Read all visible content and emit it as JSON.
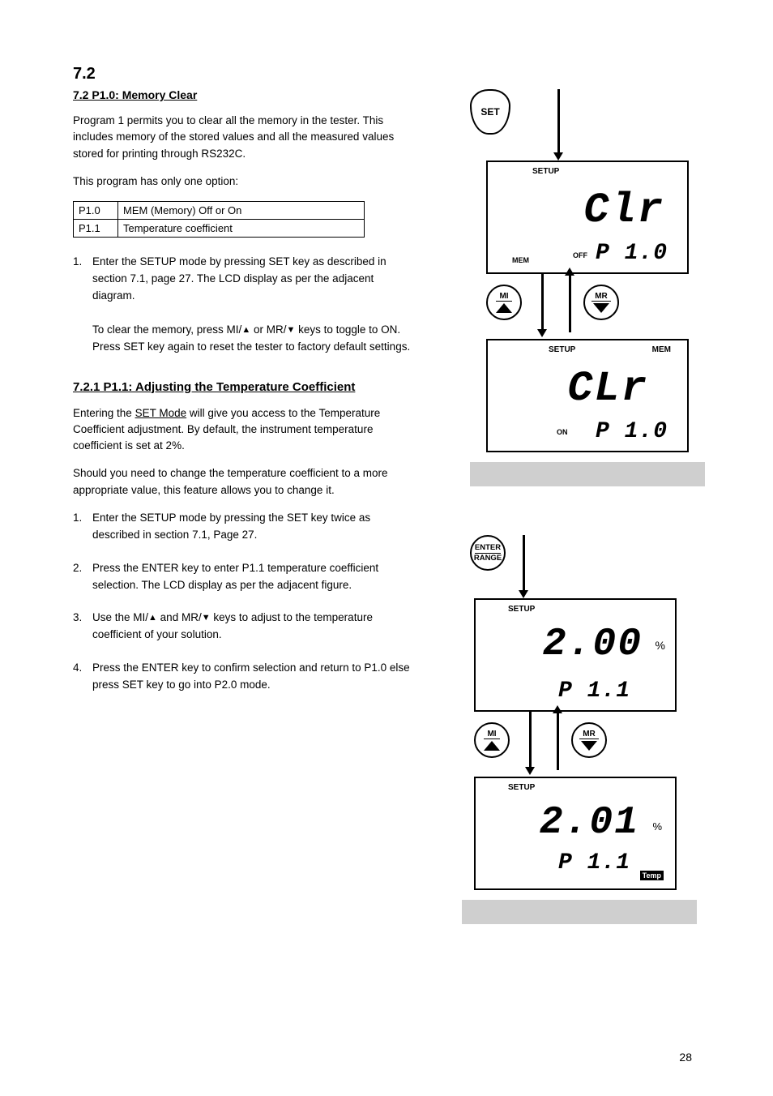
{
  "section": {
    "title": "7.2 P1.0: Memory Clear",
    "para1": "Program 1 permits you to clear all the memory in the tester. This includes memory of the stored values and all the measured values stored for printing through RS232C.",
    "para2": "This program has only one option:",
    "table": {
      "row1": {
        "code": "P1.0",
        "desc": "MEM (Memory) Off or On"
      },
      "row2": {
        "code": "P1.1",
        "desc": "Temperature coefficient"
      }
    },
    "step1_pre": "Enter the SETUP mode by pressing SET key as described in section 7.1, page 27. The LCD display as per the adjacent diagram.",
    "step1_post": "To clear the memory, press MI/▲ or MR/▼ keys to toggle to ON. Press SET key again to reset the tester to factory default settings.",
    "p11_title": "7.2.1 P1.1: Adjusting the Temperature Coefficient",
    "p11_para1_a": "Entering the SET Mode will give you access to the Temperature Coefficient adjustment. By default, the instrument temperature coefficient is set at 2%. ",
    "p11_para1_b": "Should you need to change the temperature coefficient to a more appropriate value, this feature allows you to change it. ",
    "p11_step1": "Enter the SETUP mode by pressing the SET key twice as described in section 7.1, Page 27.",
    "p11_step2": "Press the ENTER key to enter P1.1 temperature coefficient selection. The LCD display as per the adjacent figure.",
    "p11_step3": "Use the MI/▲ and MR/▼ keys to adjust to the temperature coefficient of your solution.",
    "p11_step4": "Press the ENTER key to confirm selection and return to P1.0 else press SET key to go into P2.0 mode."
  },
  "lcd": {
    "a": {
      "setup": "SETUP",
      "big": "Clr",
      "mem": "MEM",
      "off": "OFF",
      "small": "P 1.0"
    },
    "b": {
      "setup": "SETUP",
      "mem_r": "MEM",
      "big": "CLr",
      "on": "ON",
      "small": "P 1.0"
    },
    "c": {
      "setup": "SETUP",
      "big": "2.00",
      "pct": "%",
      "small": "P 1.1"
    },
    "d": {
      "setup": "SETUP",
      "big": "2.01",
      "pct": "%",
      "small": "P 1.1",
      "temp": "Temp"
    }
  },
  "keys": {
    "set": "SET",
    "mi": "MI",
    "mr": "MR",
    "enter_top": "ENTER",
    "enter_bot": "RANGE"
  },
  "pagenum": "28"
}
